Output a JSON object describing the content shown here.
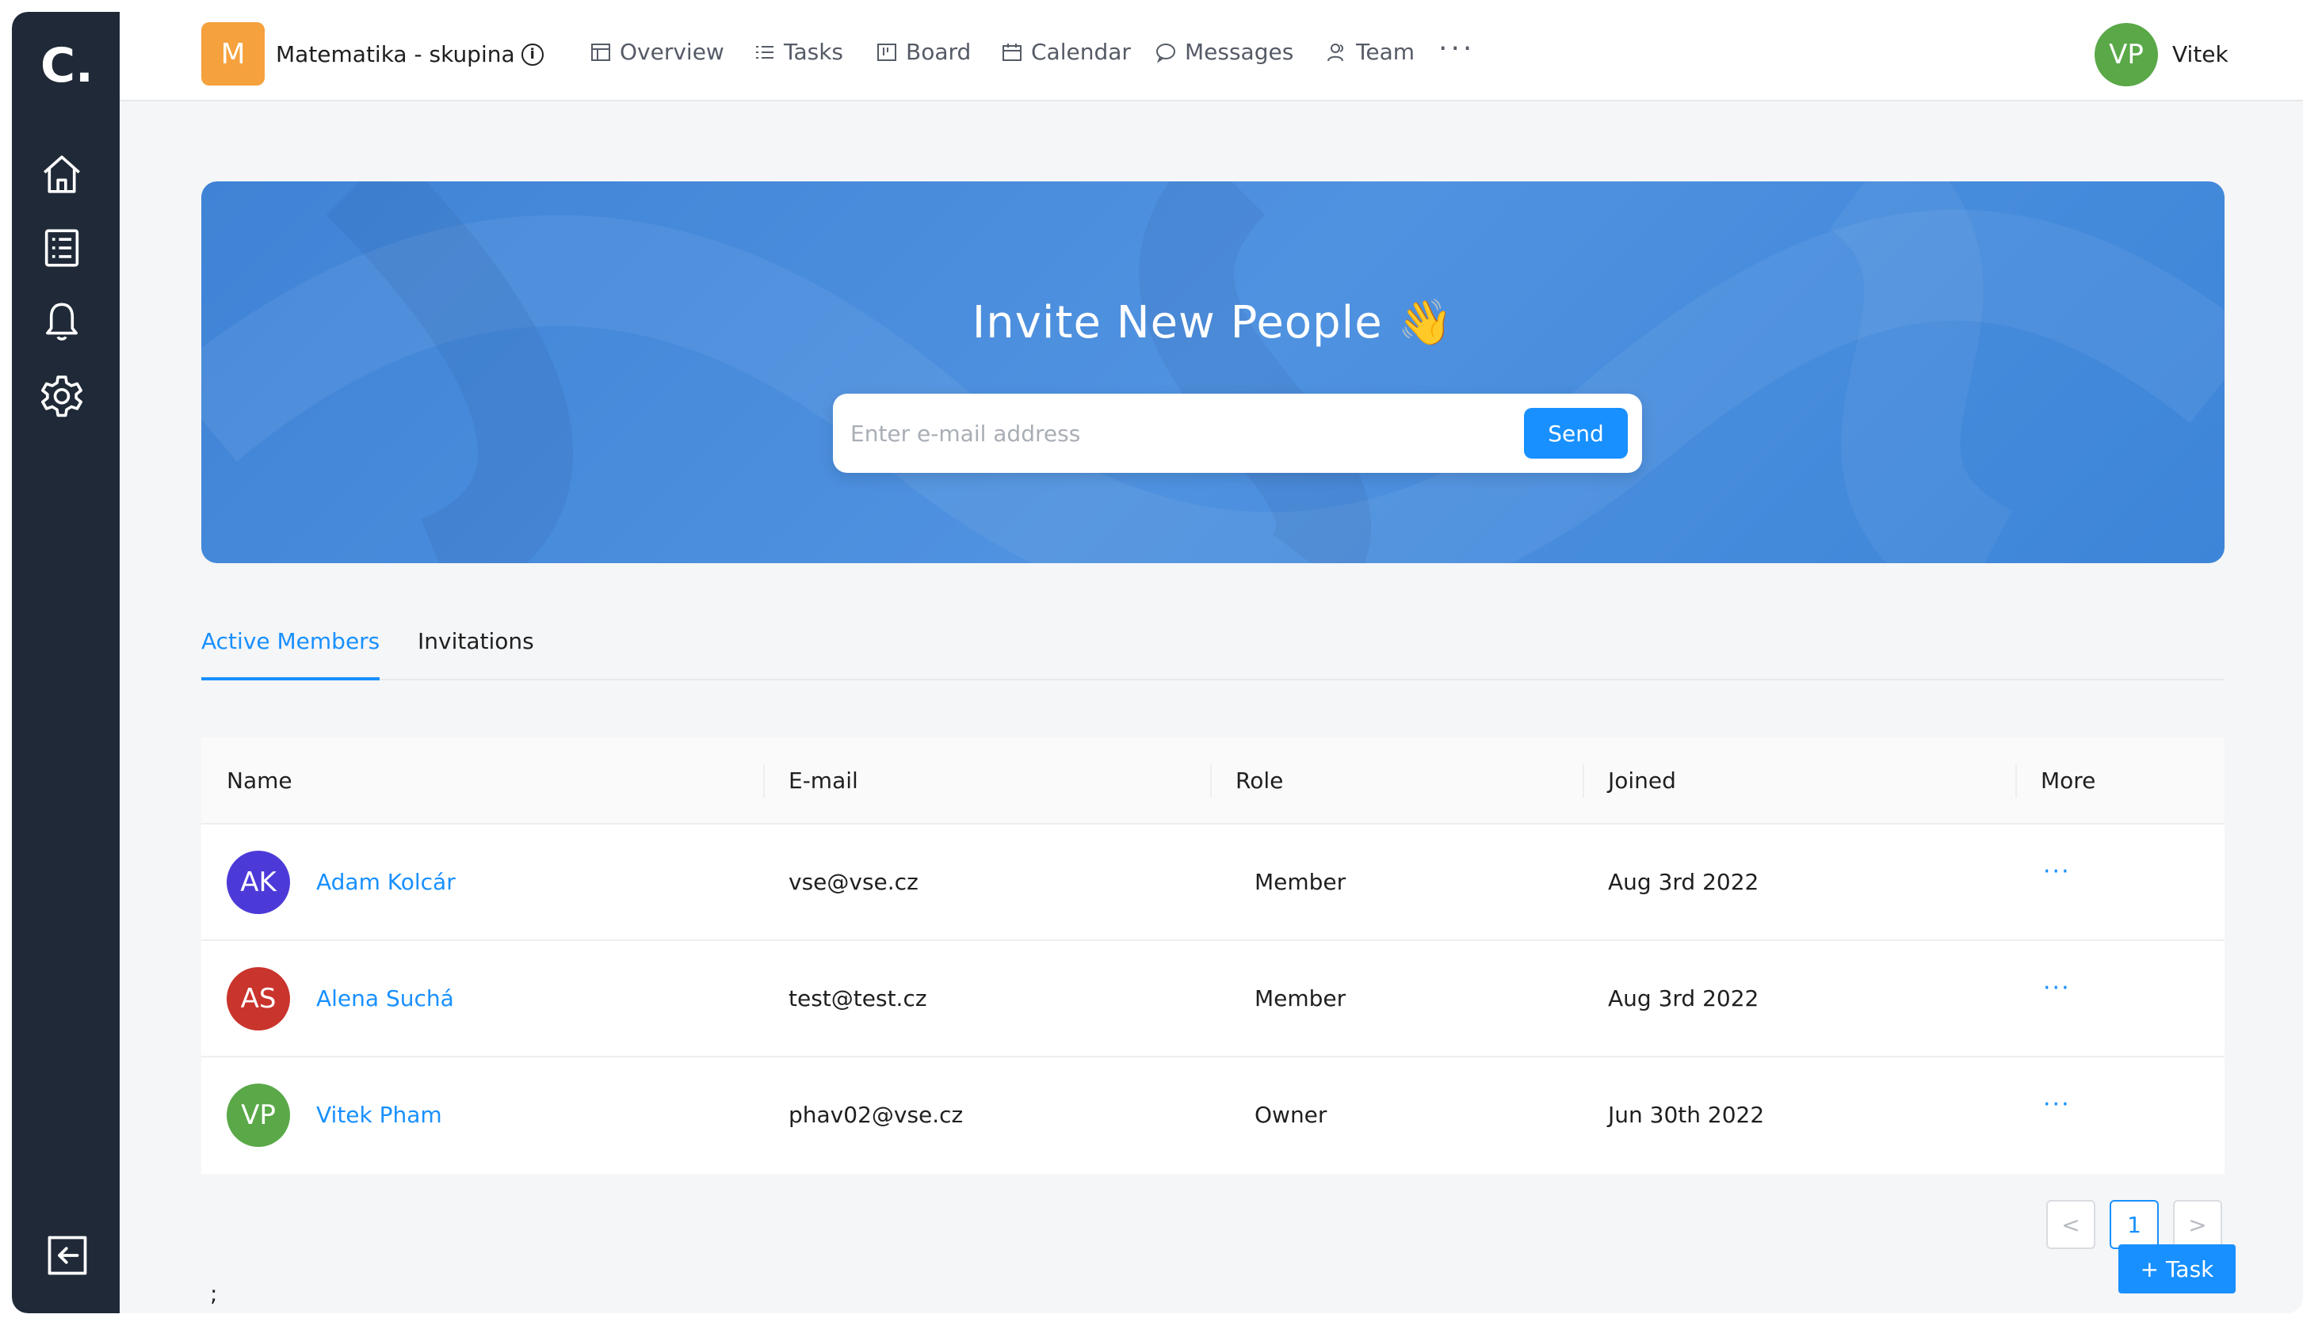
{
  "app": {
    "logo_text": "C."
  },
  "sidebar": {
    "items": [
      {
        "icon": "home-icon"
      },
      {
        "icon": "list-icon"
      },
      {
        "icon": "bell-icon"
      },
      {
        "icon": "gear-icon"
      }
    ],
    "bottom_icon": "logout-icon"
  },
  "header": {
    "project_initial": "M",
    "project_name": "Matematika - skupina",
    "nav": [
      {
        "label": "Overview",
        "icon": "overview-icon"
      },
      {
        "label": "Tasks",
        "icon": "tasks-icon"
      },
      {
        "label": "Board",
        "icon": "board-icon"
      },
      {
        "label": "Calendar",
        "icon": "calendar-icon"
      },
      {
        "label": "Messages",
        "icon": "messages-icon"
      },
      {
        "label": "Team",
        "icon": "team-icon"
      }
    ],
    "more": "···",
    "user_initials": "VP",
    "user_name": "Vitek"
  },
  "invite": {
    "title": "Invite New People 👋",
    "placeholder": "Enter e-mail address",
    "send_label": "Send"
  },
  "tabs": [
    {
      "label": "Active Members",
      "active": true
    },
    {
      "label": "Invitations",
      "active": false
    }
  ],
  "table": {
    "columns": [
      "Name",
      "E-mail",
      "Role",
      "Joined",
      "More"
    ],
    "rows": [
      {
        "initials": "AK",
        "avatar_color": "#4c3ad8",
        "name": "Adam Kolcár",
        "email": "vse@vse.cz",
        "role": "Member",
        "joined": "Aug 3rd 2022",
        "more": "···"
      },
      {
        "initials": "AS",
        "avatar_color": "#c9342c",
        "name": "Alena Suchá",
        "email": "test@test.cz",
        "role": "Member",
        "joined": "Aug 3rd 2022",
        "more": "···"
      },
      {
        "initials": "VP",
        "avatar_color": "#5aa848",
        "name": "Vitek Pham",
        "email": "phav02@vse.cz",
        "role": "Owner",
        "joined": "Jun 30th 2022",
        "more": "···"
      }
    ]
  },
  "pagination": {
    "prev": "<",
    "current": "1",
    "next": ">"
  },
  "task_button": "+ Task",
  "stray_text": ";",
  "colors": {
    "accent": "#1890ff",
    "sidebar_bg": "#1f2937",
    "project_badge": "#f5a13d",
    "banner": "#4a8ddc"
  }
}
